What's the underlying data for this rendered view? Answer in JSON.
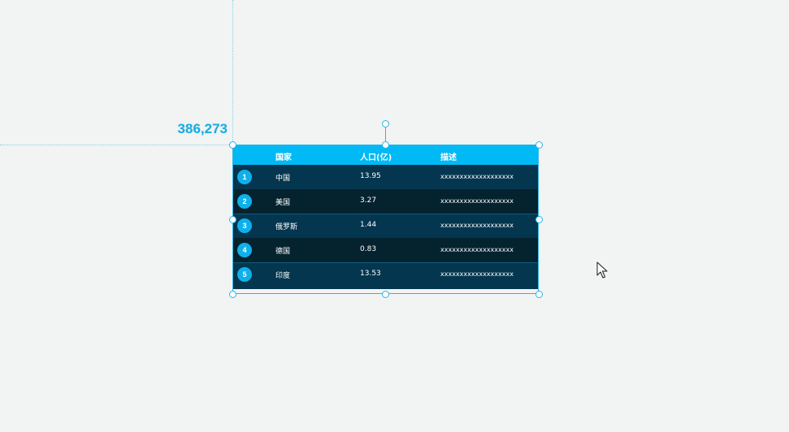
{
  "coordinate_readout": "386,273",
  "table": {
    "headers": {
      "country": "国家",
      "population": "人口(亿)",
      "description": "描述"
    },
    "rows": [
      {
        "rank": "1",
        "country": "中国",
        "population": "13.95",
        "description": "xxxxxxxxxxxxxxxxxxx"
      },
      {
        "rank": "2",
        "country": "美国",
        "population": "3.27",
        "description": "xxxxxxxxxxxxxxxxxxx"
      },
      {
        "rank": "3",
        "country": "俄罗斯",
        "population": "1.44",
        "description": "xxxxxxxxxxxxxxxxxxx"
      },
      {
        "rank": "4",
        "country": "德国",
        "population": "0.83",
        "description": "xxxxxxxxxxxxxxxxxxx"
      },
      {
        "rank": "5",
        "country": "印度",
        "population": "13.53",
        "description": "xxxxxxxxxxxxxxxxxxx"
      }
    ]
  },
  "colors": {
    "header_bg": "#00b9f5",
    "row_odd_bg": "#04364f",
    "row_even_bg": "#05222f",
    "badge": "#0fb0ea",
    "selection": "#29b6e8",
    "canvas_bg": "#f2f3f3"
  },
  "icons": {
    "cursor": "mouse-pointer-icon"
  }
}
